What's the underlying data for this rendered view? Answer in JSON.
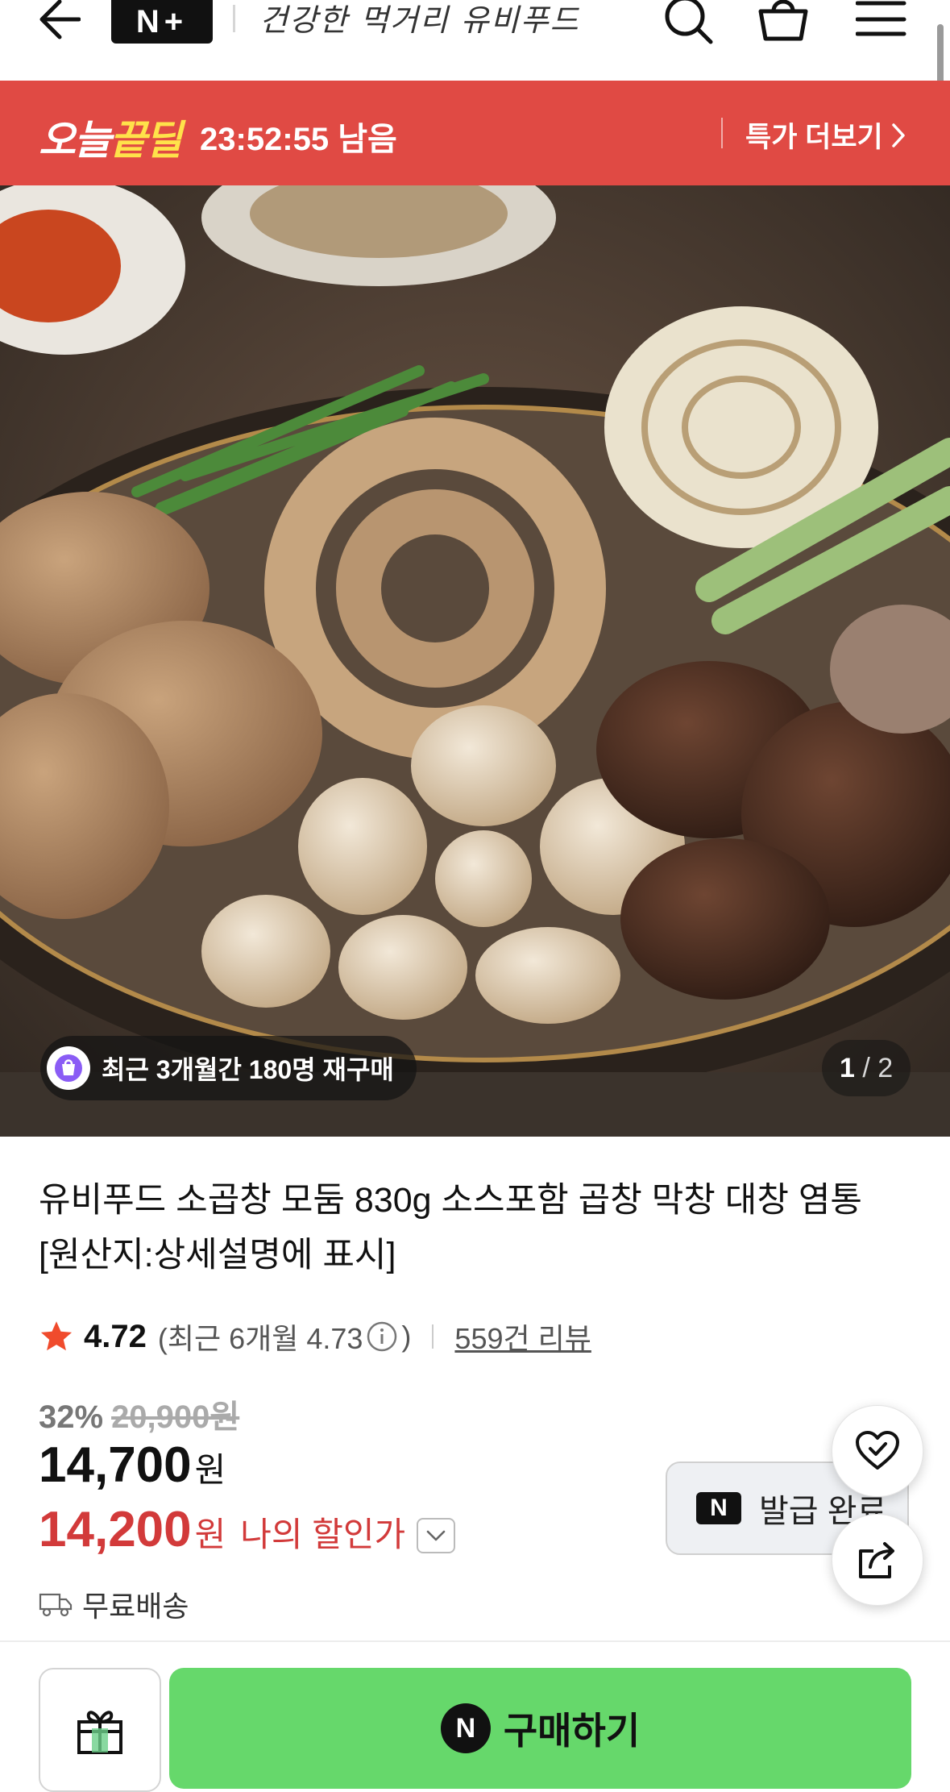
{
  "header": {
    "brand_badge": "N+",
    "store_name": "건강한 먹거리 유비푸드",
    "icons": [
      "back-arrow-icon",
      "search-icon",
      "cart-icon",
      "menu-icon"
    ]
  },
  "deal_bar": {
    "logo_part1": "오늘",
    "logo_part2": "끝딜",
    "timer": "23:52:55 남음",
    "more_label": "특가 더보기",
    "color": "#e04a44"
  },
  "image": {
    "repurchase_text": "최근 3개월간 180명 재구매",
    "page_current": "1",
    "page_sep": "/",
    "page_total": "2"
  },
  "product": {
    "title": "유비푸드 소곱창 모둠 830g 소스포함 곱창 막창 대창 염통 [원산지:상세설명에 표시]",
    "rating": "4.72",
    "recent_rating": "(최근 6개월 4.73",
    "recent_rating_close": ")",
    "reviews": "559건 리뷰",
    "discount_rate": "32%",
    "original_price": "20,900원",
    "price": "14,700",
    "price_unit": "원",
    "my_price": "14,200",
    "my_price_unit": "원",
    "my_price_label": "나의 할인가",
    "shipping": "무료배송",
    "coupon_label": "발급 완료",
    "coupon_badge": "N"
  },
  "bottom_bar": {
    "buy_label": "구매하기",
    "buy_badge": "N",
    "buy_color": "#66d86b"
  }
}
